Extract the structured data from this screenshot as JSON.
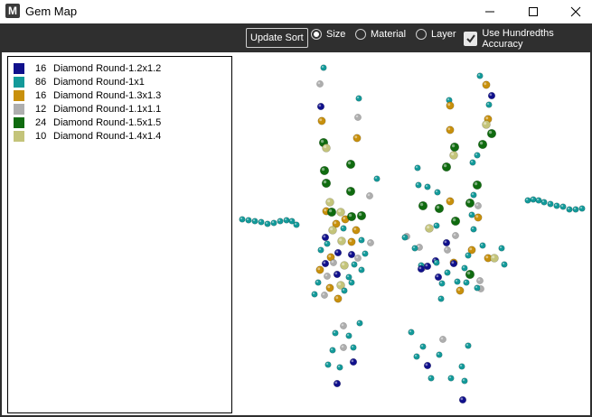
{
  "window": {
    "title": "Gem Map"
  },
  "toolbar": {
    "update_label": "Update Sort",
    "radio_size": "Size",
    "radio_material": "Material",
    "radio_layer": "Layer",
    "selected": "Size",
    "checkbox_label": "Use Hundredths Accuracy",
    "checkbox_checked": true
  },
  "legend": {
    "items": [
      {
        "count": "16",
        "label": "Diamond Round-1.2x1.2",
        "color": "#10108c"
      },
      {
        "count": "86",
        "label": "Diamond Round-1x1",
        "color": "#139a9a"
      },
      {
        "count": "16",
        "label": "Diamond Round-1.3x1.3",
        "color": "#c8900c"
      },
      {
        "count": "12",
        "label": "Diamond Round-1.1x1.1",
        "color": "#aeaeae"
      },
      {
        "count": "24",
        "label": "Diamond Round-1.5x1.5",
        "color": "#0f6b0f"
      },
      {
        "count": "10",
        "label": "Diamond Round-1.4x1.4",
        "color": "#c4c47a"
      }
    ]
  },
  "gem_colors": {
    "1.2": "#10108c",
    "1": "#139a9a",
    "1.3": "#c8900c",
    "1.1": "#aeaeae",
    "1.5": "#0f6b0f",
    "1.4": "#c4c47a"
  }
}
